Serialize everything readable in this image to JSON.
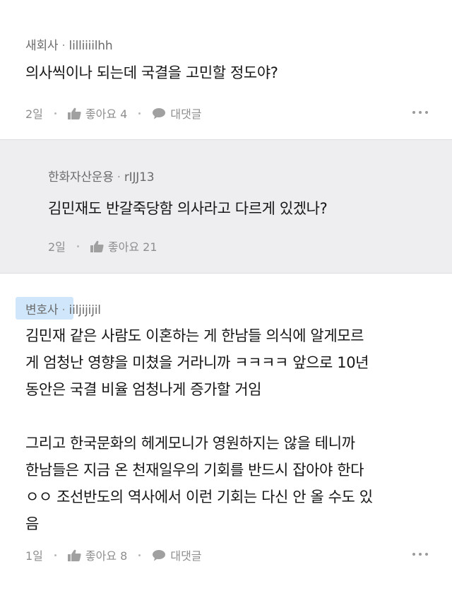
{
  "comments": [
    {
      "company": "새회사",
      "separator": "·",
      "nickname": "lilliiiilhh",
      "lines": [
        "의사씩이나 되는데 국결을 고민할 정도야?"
      ],
      "time": "2일",
      "like_label": "좋아요 4",
      "reply_label": "대댓글"
    },
    {
      "company": "한화자산운용",
      "separator": "·",
      "nickname": "rIJJ13",
      "lines": [
        "김민재도 반갈죽당함 의사라고 다르게 있겠나?"
      ],
      "time": "2일",
      "like_label": "좋아요 21"
    },
    {
      "company": "변호사",
      "separator": "·",
      "nickname": "iiljijijil",
      "paragraph1": [
        "김민재 같은 사람도 이혼하는 게 한남들 의식에 알게모르",
        "게 엄청난 영향을 미쳤을 거라니까 ㅋㅋㅋㅋ 앞으로 10년",
        "동안은 국결 비율 엄청나게 증가할 거임"
      ],
      "paragraph2": [
        "그리고 한국문화의 헤게모니가 영원하지는 않을 테니까",
        "한남들은 지금 온 천재일우의 기회를 반드시 잡아야 한다",
        "ㅇㅇ 조선반도의 역사에서 이런 기회는 다신 안 올 수도 있",
        "음"
      ],
      "time": "1일",
      "like_label": "좋아요 8",
      "reply_label": "대댓글"
    }
  ],
  "colors": {
    "reply_background": "#eeeef1",
    "highlight": "#cfe6fb",
    "meta_text": "#8e8e8e"
  },
  "icons": [
    "thumbs-up-icon",
    "speech-bubble-icon",
    "more-options-icon"
  ]
}
